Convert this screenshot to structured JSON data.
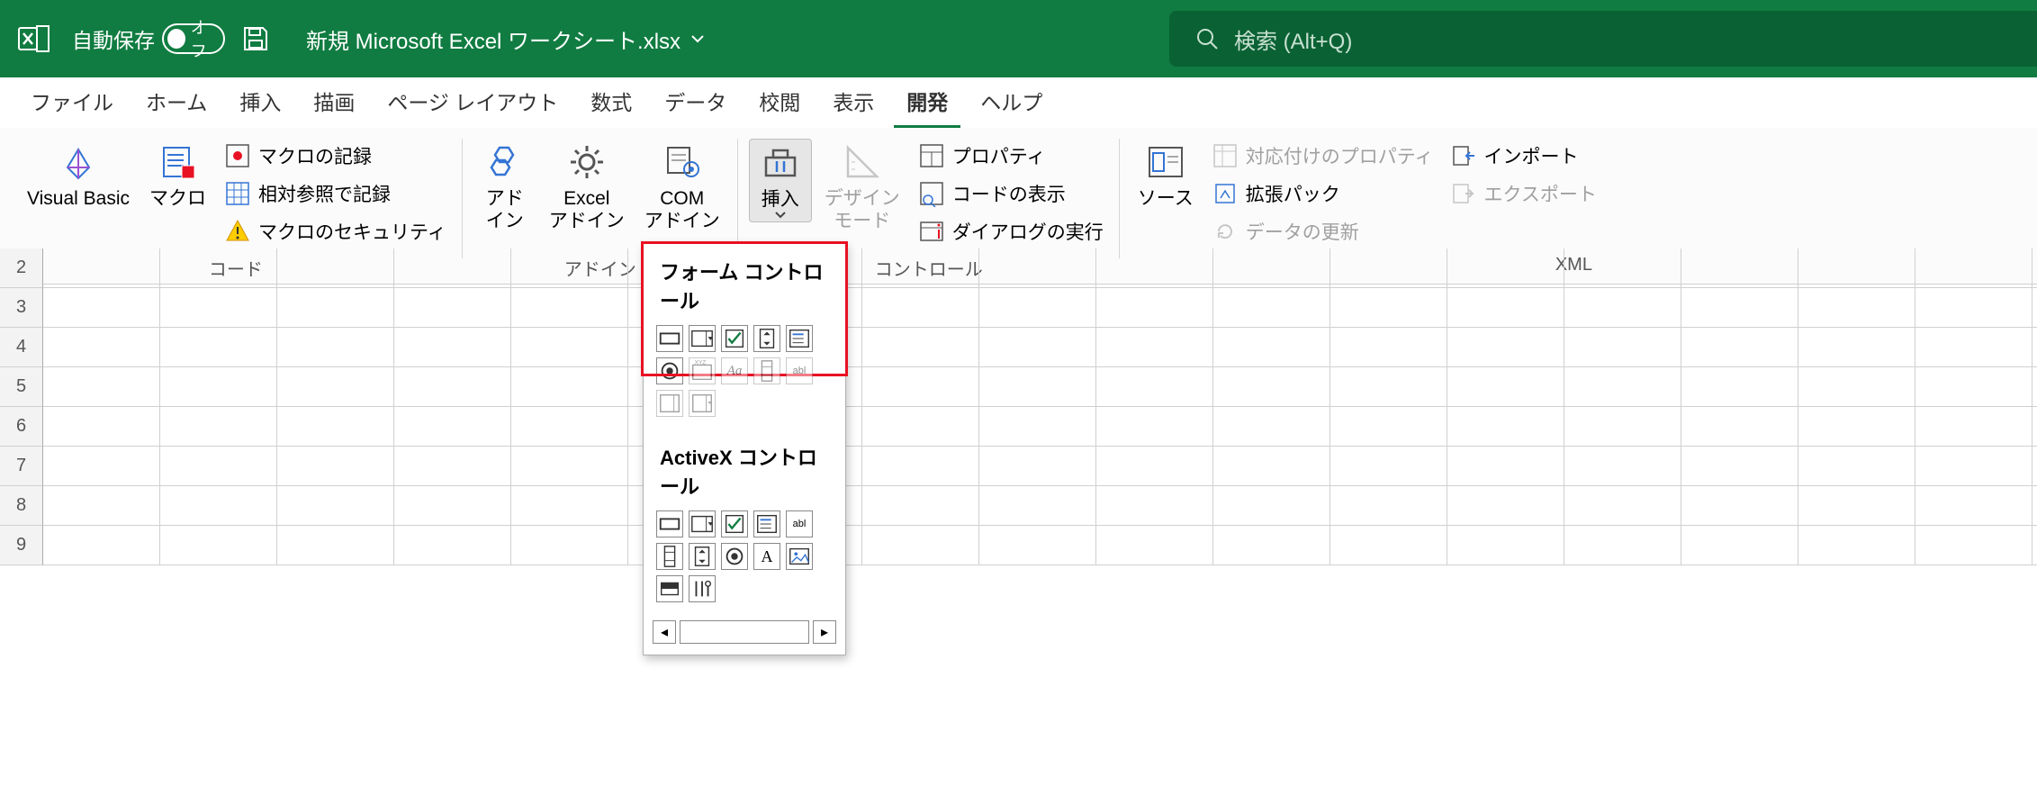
{
  "titlebar": {
    "autosave_label": "自動保存",
    "autosave_state": "オフ",
    "filename": "新規 Microsoft Excel ワークシート.xlsx",
    "search_placeholder": "検索 (Alt+Q)"
  },
  "tabs": [
    {
      "id": "file",
      "label": "ファイル"
    },
    {
      "id": "home",
      "label": "ホーム"
    },
    {
      "id": "insert",
      "label": "挿入"
    },
    {
      "id": "draw",
      "label": "描画"
    },
    {
      "id": "page-layout",
      "label": "ページ レイアウト"
    },
    {
      "id": "formulas",
      "label": "数式"
    },
    {
      "id": "data",
      "label": "データ"
    },
    {
      "id": "review",
      "label": "校閲"
    },
    {
      "id": "view",
      "label": "表示"
    },
    {
      "id": "developer",
      "label": "開発",
      "active": true
    },
    {
      "id": "help",
      "label": "ヘルプ"
    }
  ],
  "ribbon": {
    "code": {
      "label": "コード",
      "visual_basic": "Visual Basic",
      "macros": "マクロ",
      "record_macro": "マクロの記録",
      "relative_ref": "相対参照で記録",
      "macro_security": "マクロのセキュリティ"
    },
    "addins": {
      "label": "アドイン",
      "addins": "アド\nイン",
      "excel_addins": "Excel\nアドイン",
      "com_addins": "COM\nアドイン"
    },
    "controls": {
      "label": "コントロール",
      "insert": "挿入",
      "design_mode": "デザイン\nモード",
      "properties": "プロパティ",
      "view_code": "コードの表示",
      "run_dialog": "ダイアログの実行"
    },
    "xml": {
      "label": "XML",
      "source": "ソース",
      "map_props": "対応付けのプロパティ",
      "expansion": "拡張パック",
      "refresh": "データの更新",
      "import": "インポート",
      "export": "エクスポート"
    }
  },
  "popup": {
    "form_controls": "フォーム コントロール",
    "activex_controls": "ActiveX コントロール"
  },
  "rows": [
    "2",
    "3",
    "4",
    "5",
    "6",
    "7",
    "8",
    "9"
  ]
}
